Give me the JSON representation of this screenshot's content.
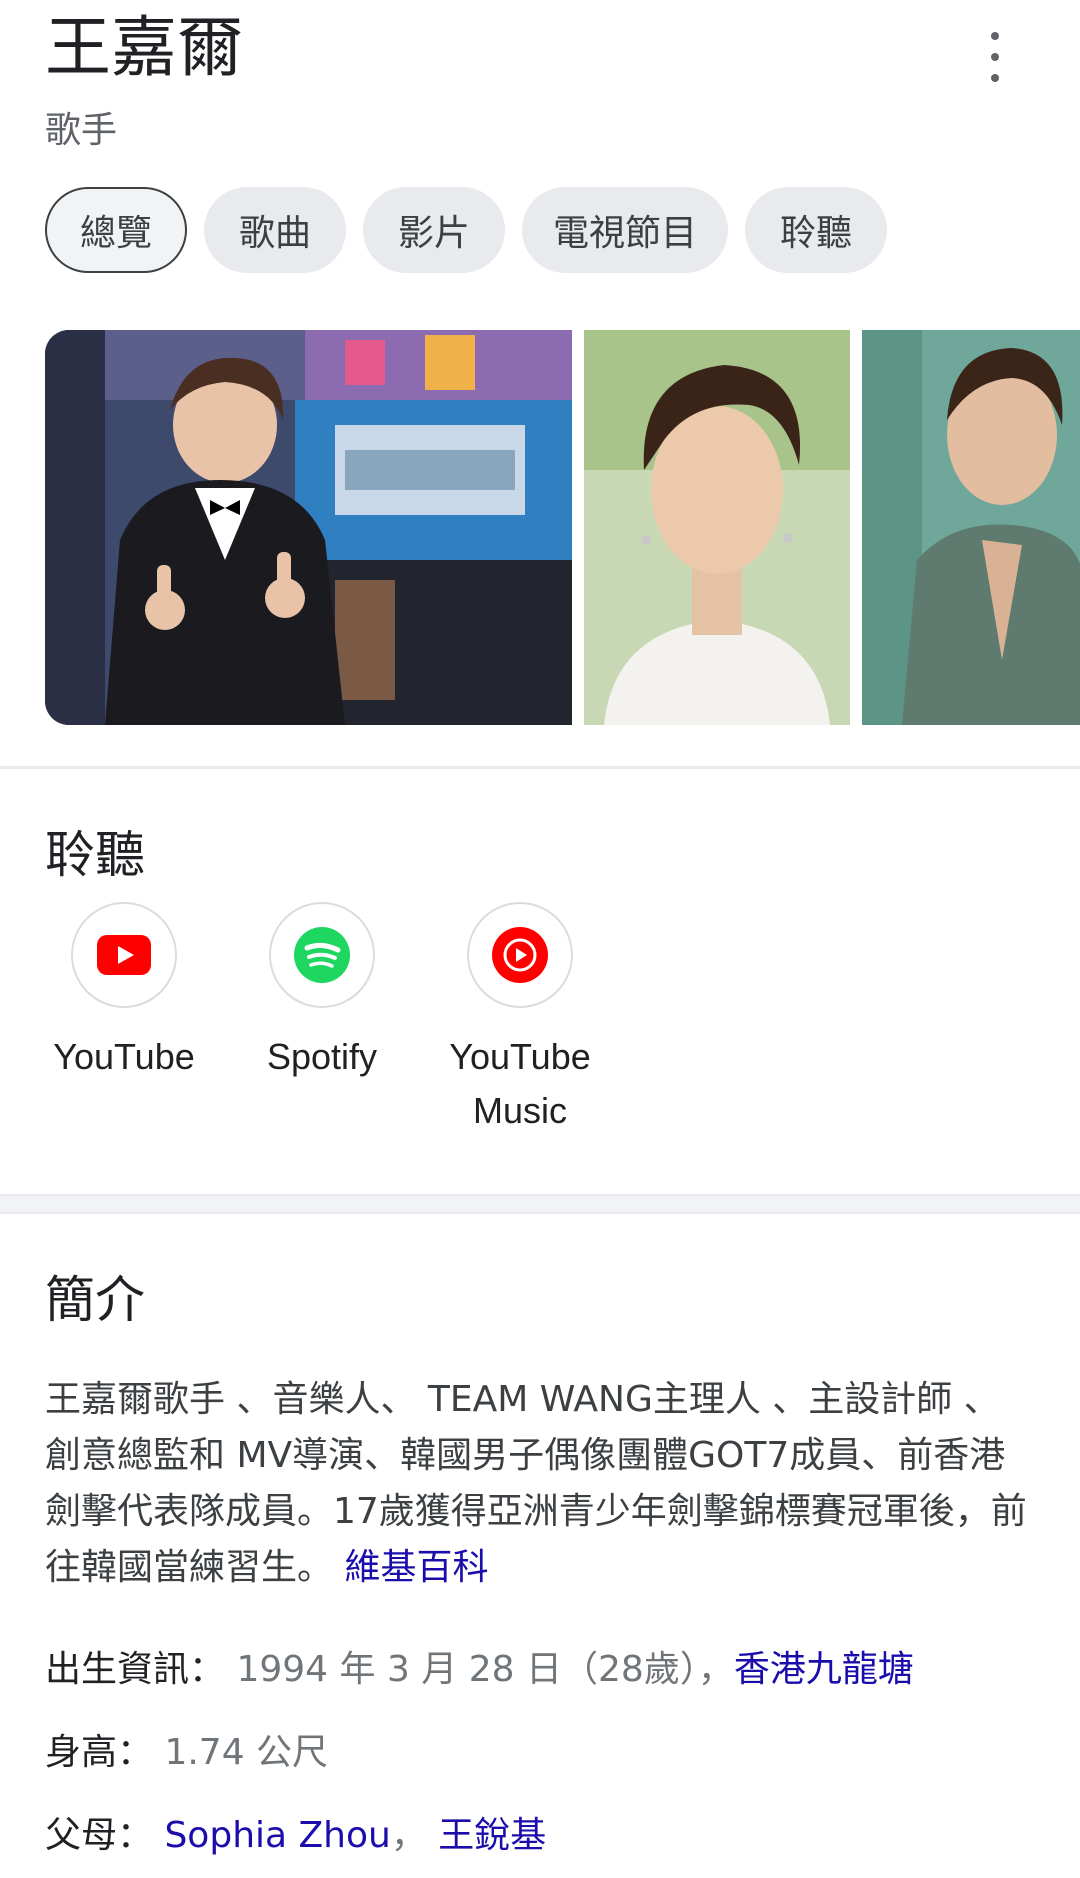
{
  "header": {
    "title": "王嘉爾",
    "subtitle": "歌手",
    "more_icon": "more-vert-icon"
  },
  "tabs": [
    {
      "label": "總覽",
      "active": true
    },
    {
      "label": "歌曲"
    },
    {
      "label": "影片"
    },
    {
      "label": "電視節目"
    },
    {
      "label": "聆聽"
    }
  ],
  "listen": {
    "title": "聆聽",
    "services": [
      {
        "label": "YouTube",
        "icon": "youtube-icon",
        "color": "#ff0000"
      },
      {
        "label": "Spotify",
        "icon": "spotify-icon",
        "color": "#1ed760"
      },
      {
        "label": "YouTube\nMusic",
        "icon": "youtube-music-icon",
        "color": "#ff0000"
      }
    ]
  },
  "intro": {
    "title": "簡介",
    "text": "王嘉爾歌手 、音樂人、 TEAM WANG主理人 、主設計師 、創意總監和 MV導演、韓國男子偶像團體GOT7成員、前香港劍擊代表隊成員。17歲獲得亞洲青少年劍擊錦標賽冠軍後，前往韓國當練習生。",
    "source_link": "維基百科"
  },
  "facts": {
    "birth": {
      "key": "出生資訊：",
      "value": " 1994 年 3 月 28 日（28歲）",
      "sep": "，",
      "link": "香港九龍塘"
    },
    "height": {
      "key": "身高：",
      "value": " 1.74 公尺"
    },
    "parents": {
      "key": "父母：",
      "link1": " Sophia Zhou",
      "sep": "， ",
      "link2": "王銳基"
    }
  },
  "colors": {
    "link": "#1a0dab",
    "chip_bg": "#e8eaed",
    "secondary_text": "#5f6368"
  }
}
